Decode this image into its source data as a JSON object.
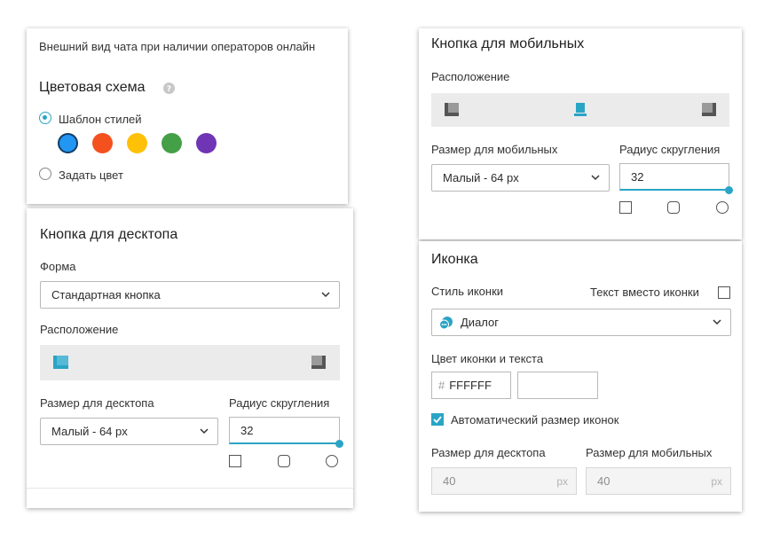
{
  "left_top": {
    "caption": "Внешний вид чата при наличии операторов онлайн",
    "color_scheme_title": "Цветовая схема",
    "help_icon": "question-circle-icon",
    "template_option": "Шаблон стилей",
    "custom_option": "Задать цвет",
    "swatches": [
      "#2196f3",
      "#f4511e",
      "#ffc107",
      "#43a047",
      "#6f35b5"
    ]
  },
  "desktop": {
    "title": "Кнопка для десктопа",
    "form_label": "Форма",
    "form_value": "Стандартная кнопка",
    "placement_label": "Расположение",
    "size_label": "Размер для десктопа",
    "radius_label": "Радиус скругления",
    "size_value": "Малый - 64 px",
    "radius_value": "32"
  },
  "mobile": {
    "title": "Кнопка для мобильных",
    "placement_label": "Расположение",
    "size_label": "Размер для мобильных",
    "radius_label": "Радиус скругления",
    "size_value": "Малый - 64 px",
    "radius_value": "32"
  },
  "icon_section": {
    "title": "Иконка",
    "style_label": "Стиль иконки",
    "text_instead_label": "Текст вместо иконки",
    "style_value": "Диалог",
    "color_label": "Цвет иконки и текста",
    "hash": "#",
    "color_value": "FFFFFF",
    "auto_size_label": "Автоматический размер иконок",
    "desktop_size_label": "Размер для десктопа",
    "mobile_size_label": "Размер для мобильных",
    "desktop_size_value": "40",
    "mobile_size_value": "40",
    "unit": "px"
  },
  "colors": {
    "accent": "#2aa4c5",
    "placement_bg": "#ebebeb"
  }
}
